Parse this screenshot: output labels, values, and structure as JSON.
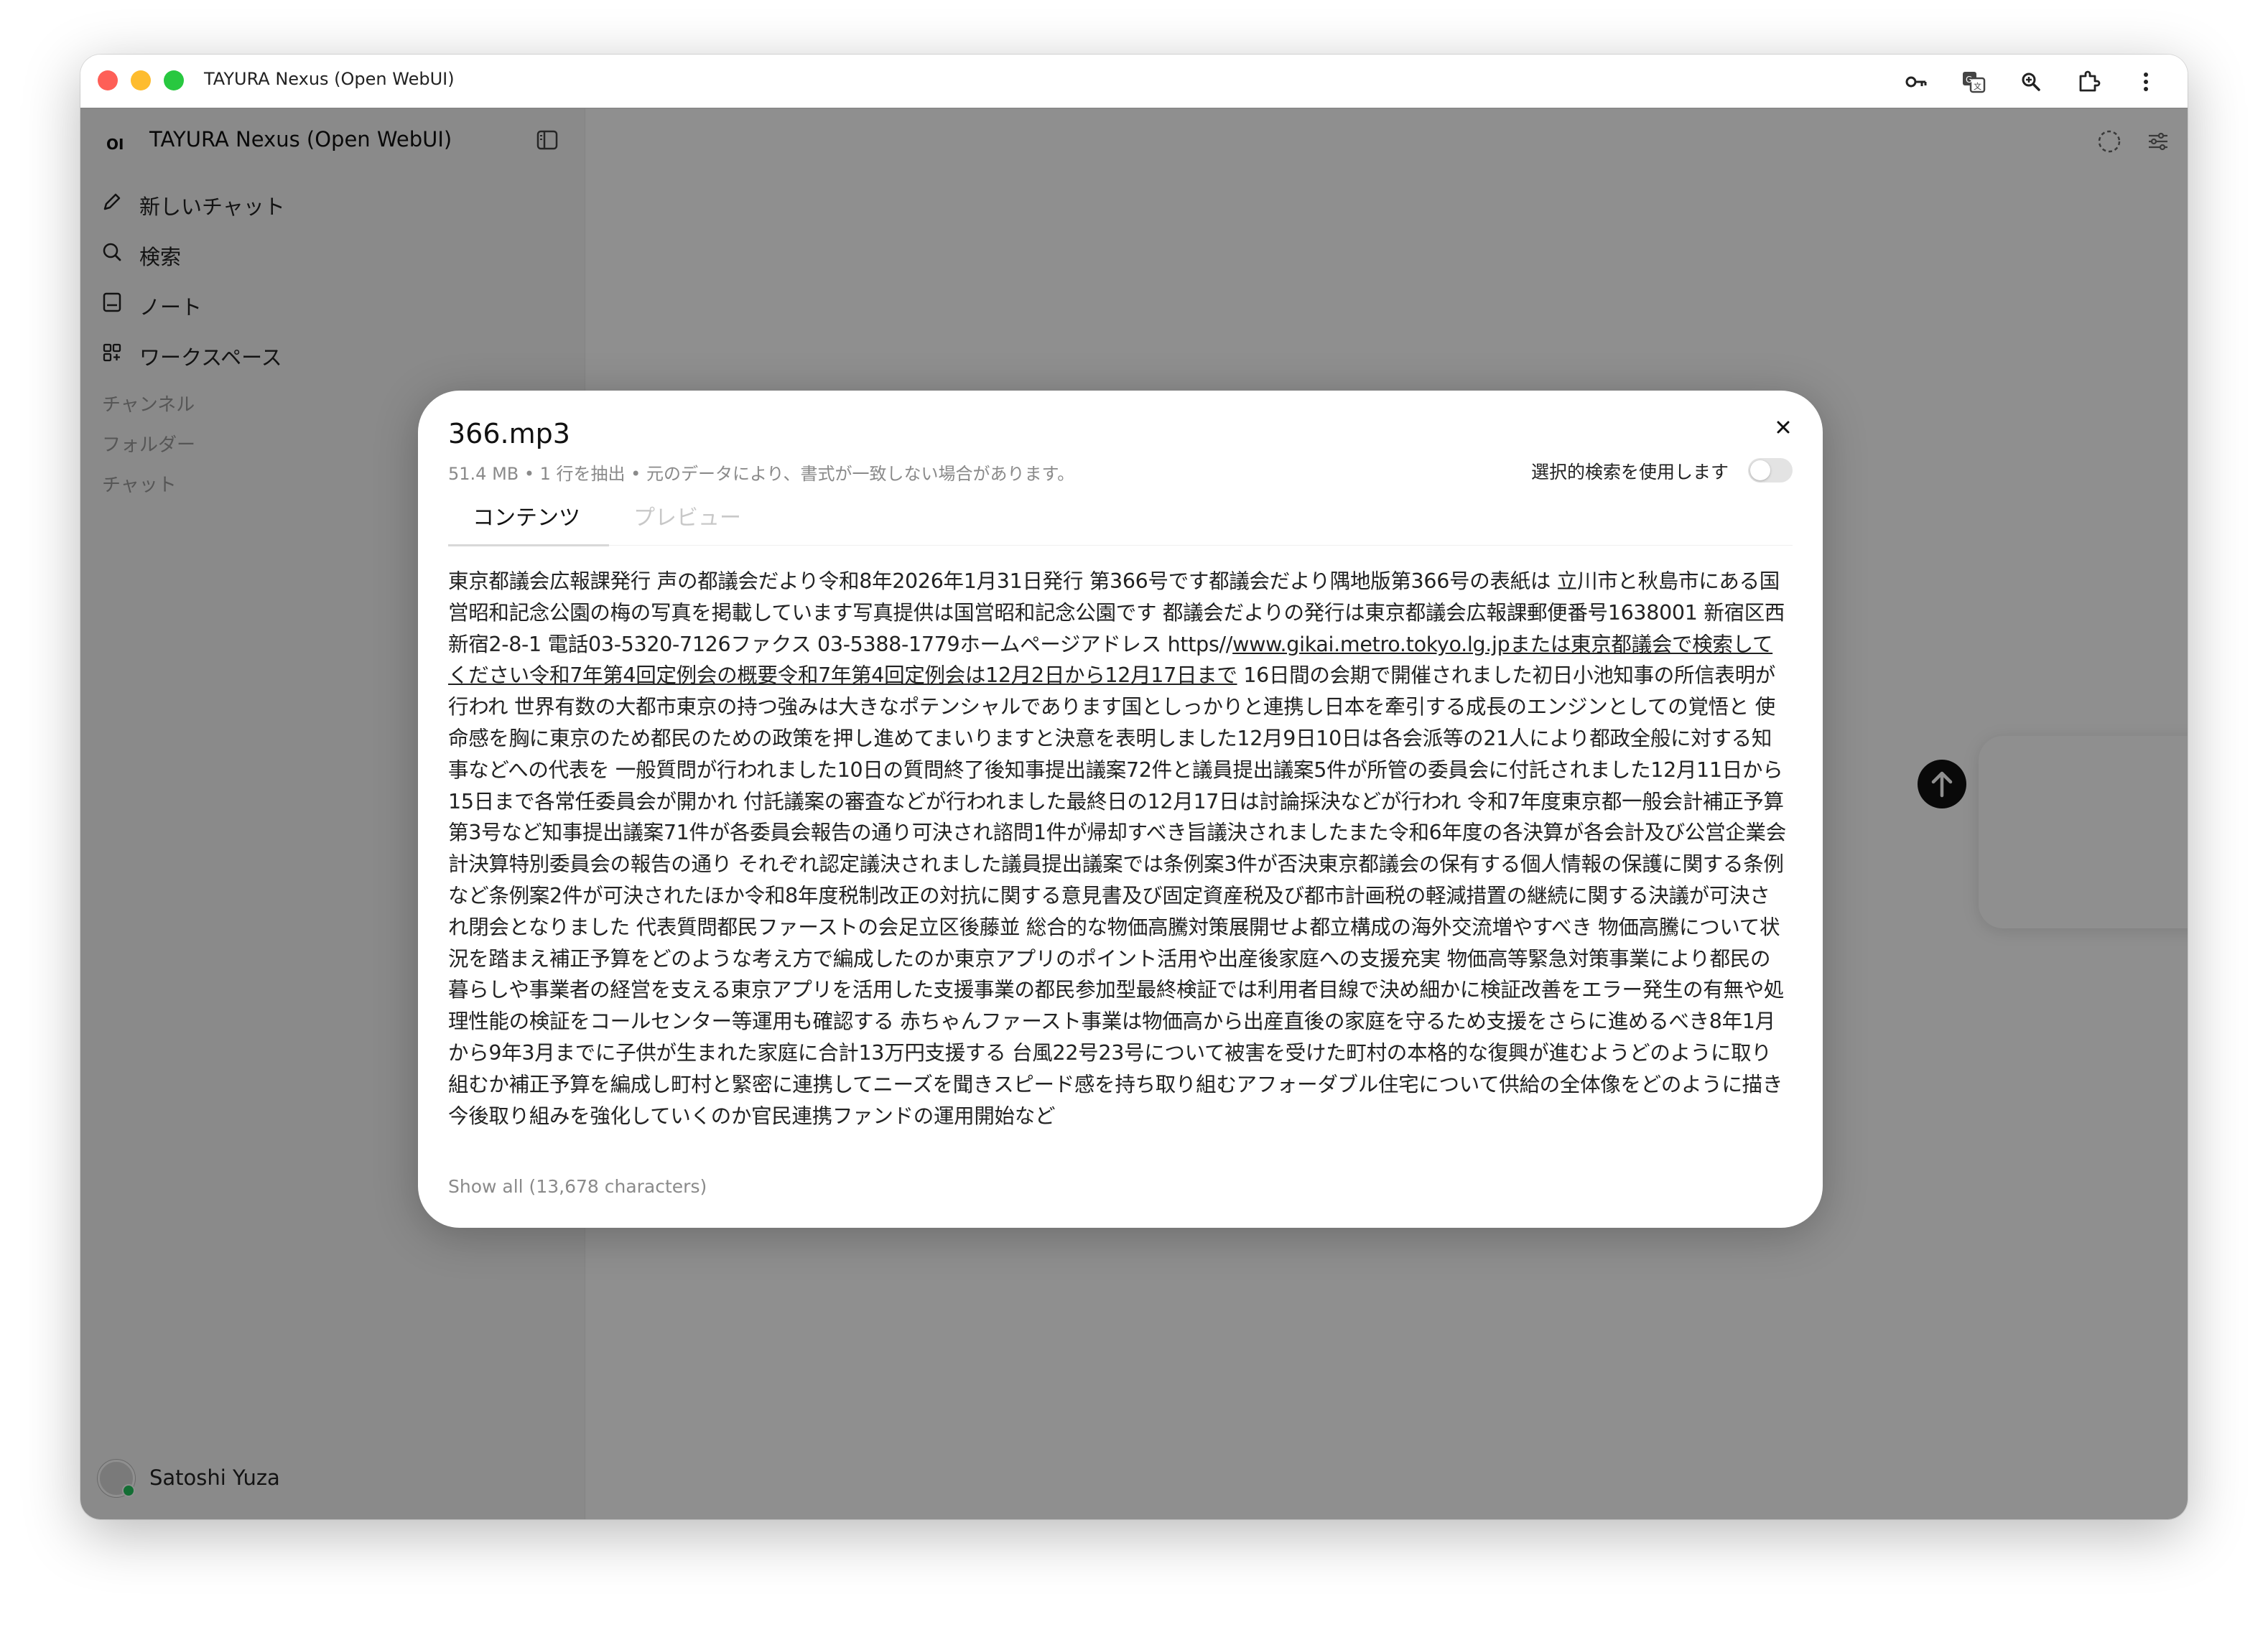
{
  "window": {
    "title": "TAYURA Nexus (Open WebUI)",
    "toolbar_icons": [
      "key-icon",
      "translate-icon",
      "zoom-icon",
      "extension-icon",
      "more-vertical-icon"
    ]
  },
  "sidebar": {
    "logo": "OI",
    "title": "TAYURA Nexus (Open WebUI)",
    "nav": [
      {
        "label": "新しいチャット",
        "icon": "pencil-icon"
      },
      {
        "label": "検索",
        "icon": "search-icon"
      },
      {
        "label": "ノート",
        "icon": "note-icon"
      },
      {
        "label": "ワークスペース",
        "icon": "grid-icon"
      }
    ],
    "sections": [
      "チャンネル",
      "フォルダー",
      "チャット"
    ],
    "user": {
      "name": "Satoshi Yuza"
    }
  },
  "modal": {
    "title": "366.mp3",
    "meta": "51.4 MB • 1 行を抽出 • 元のデータにより、書式が一致しない場合があります。",
    "toggle_label": "選択的検索を使用します",
    "toggle_on": false,
    "tabs": [
      "コンテンツ",
      "プレビュー"
    ],
    "active_tab": "コンテンツ",
    "body_part1": "東京都議会広報課発行 声の都議会だより令和8年2026年1月31日発行 第366号です都議会だより隅地版第366号の表紙は 立川市と秋島市にある国営昭和記念公園の梅の写真を掲載しています写真提供は国営昭和記念公園です 都議会だよりの発行は東京都議会広報課郵便番号1638001 新宿区西新宿2-8-1 電話03-5320-7126ファクス 03-5388-1779ホームページアドレス https//",
    "body_link": "www.gikai.metro.tokyo.lg.jpまたは東京都議会で検索してください令和7年第4回定例会の概要令和7年第4回定例会は12月2日から12月17日まで",
    "body_part2": " 16日間の会期で開催されました初日小池知事の所信表明が行われ 世界有数の大都市東京の持つ強みは大きなポテンシャルであります国としっかりと連携し日本を牽引する成長のエンジンとしての覚悟と 使命感を胸に東京のため都民のための政策を押し進めてまいりますと決意を表明しました12月9日10日は各会派等の21人により都政全般に対する知事などへの代表を 一般質問が行われました10日の質問終了後知事提出議案72件と議員提出議案5件が所管の委員会に付託されました12月11日から15日まで各常任委員会が開かれ 付託議案の審査などが行われました最終日の12月17日は討論採決などが行われ 令和7年度東京都一般会計補正予算第3号など知事提出議案71件が各委員会報告の通り可決され諮問1件が帰却すべき旨議決されましたまた令和6年度の各決算が各会計及び公営企業会計決算特別委員会の報告の通り それぞれ認定議決されました議員提出議案では条例案3件が否決東京都議会の保有する個人情報の保護に関する条例 など条例案2件が可決されたほか令和8年度税制改正の対抗に関する意見書及び固定資産税及び都市計画税の軽減措置の継続に関する決議が可決され閉会となりました 代表質問都民ファーストの会足立区後藤並 総合的な物価高騰対策展開せよ都立構成の海外交流増やすべき 物価高騰について状況を踏まえ補正予算をどのような考え方で編成したのか東京アプリのポイント活用や出産後家庭への支援充実 物価高等緊急対策事業により都民の暮らしや事業者の経営を支える東京アプリを活用した支援事業の都民参加型最終検証では利用者目線で決め細かに検証改善をエラー発生の有無や処理性能の検証をコールセンター等運用も確認する 赤ちゃんファースト事業は物価高から出産直後の家庭を守るため支援をさらに進めるべき8年1月から9年3月までに子供が生まれた家庭に合計13万円支援する 台風22号23号について被害を受けた町村の本格的な復興が進むようどのように取り組むか補正予算を編成し町村と緊密に連携してニーズを聞きスピード感を持ち取り組むアフォーダブル住宅について供給の全体像をどのように描き今後取り組みを強化していくのか官民連携ファンドの運用開始など",
    "show_all": "Show all (13,678 characters)"
  }
}
